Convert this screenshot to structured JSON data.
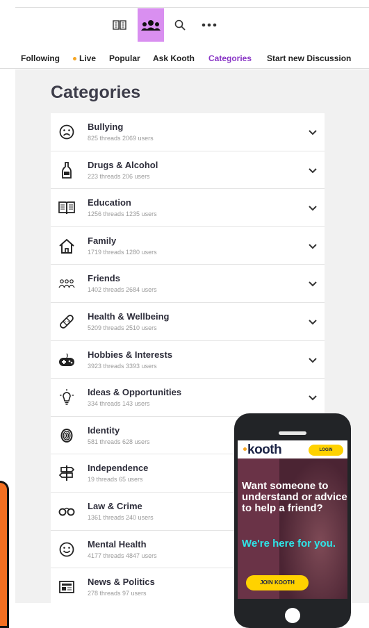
{
  "toolbar": {
    "icons": [
      "reader-icon",
      "community-icon",
      "search-icon",
      "more-icon"
    ],
    "active_color": "#d98ff0"
  },
  "nav": {
    "items": [
      {
        "label": "Following"
      },
      {
        "label": "Live"
      },
      {
        "label": "Popular"
      },
      {
        "label": "Ask Kooth"
      },
      {
        "label": "Categories"
      },
      {
        "label": "Start new Discussion"
      }
    ],
    "active": "Categories",
    "active_color": "#8a37c6",
    "live_dot_color": "#f6a623"
  },
  "page": {
    "title": "Categories"
  },
  "categories": [
    {
      "name": "Bullying",
      "stats": "825 threads 2069 users",
      "icon": "sad-face-icon"
    },
    {
      "name": "Drugs & Alcohol",
      "stats": "223 threads 206 users",
      "icon": "bottle-icon"
    },
    {
      "name": "Education",
      "stats": "1256 threads 1235 users",
      "icon": "book-icon"
    },
    {
      "name": "Family",
      "stats": "1719 threads 1280 users",
      "icon": "house-icon"
    },
    {
      "name": "Friends",
      "stats": "1402 threads 2684 users",
      "icon": "friends-icon"
    },
    {
      "name": "Health & Wellbeing",
      "stats": "5209 threads 2510 users",
      "icon": "bandage-icon"
    },
    {
      "name": "Hobbies & Interests",
      "stats": "3923 threads 3393 users",
      "icon": "gamepad-icon"
    },
    {
      "name": "Ideas & Opportunities",
      "stats": "334 threads 143 users",
      "icon": "lightbulb-icon"
    },
    {
      "name": "Identity",
      "stats": "581 threads 628 users",
      "icon": "fingerprint-icon"
    },
    {
      "name": "Independence",
      "stats": "19 threads 65 users",
      "icon": "signpost-icon"
    },
    {
      "name": "Law & Crime",
      "stats": "1361 threads 240 users",
      "icon": "handcuffs-icon"
    },
    {
      "name": "Mental Health",
      "stats": "4177 threads 4847 users",
      "icon": "smile-icon"
    },
    {
      "name": "News & Politics",
      "stats": "278 threads 97 users",
      "icon": "newspaper-icon"
    }
  ],
  "promo": {
    "logo": "kooth",
    "login": "LOGIN",
    "headline": "Want someone to understand or advice to help a friend?",
    "subline": "We're here for you.",
    "cta": "JOIN KOOTH",
    "accent": "#ffd200",
    "highlight": "#2ee5e8"
  }
}
